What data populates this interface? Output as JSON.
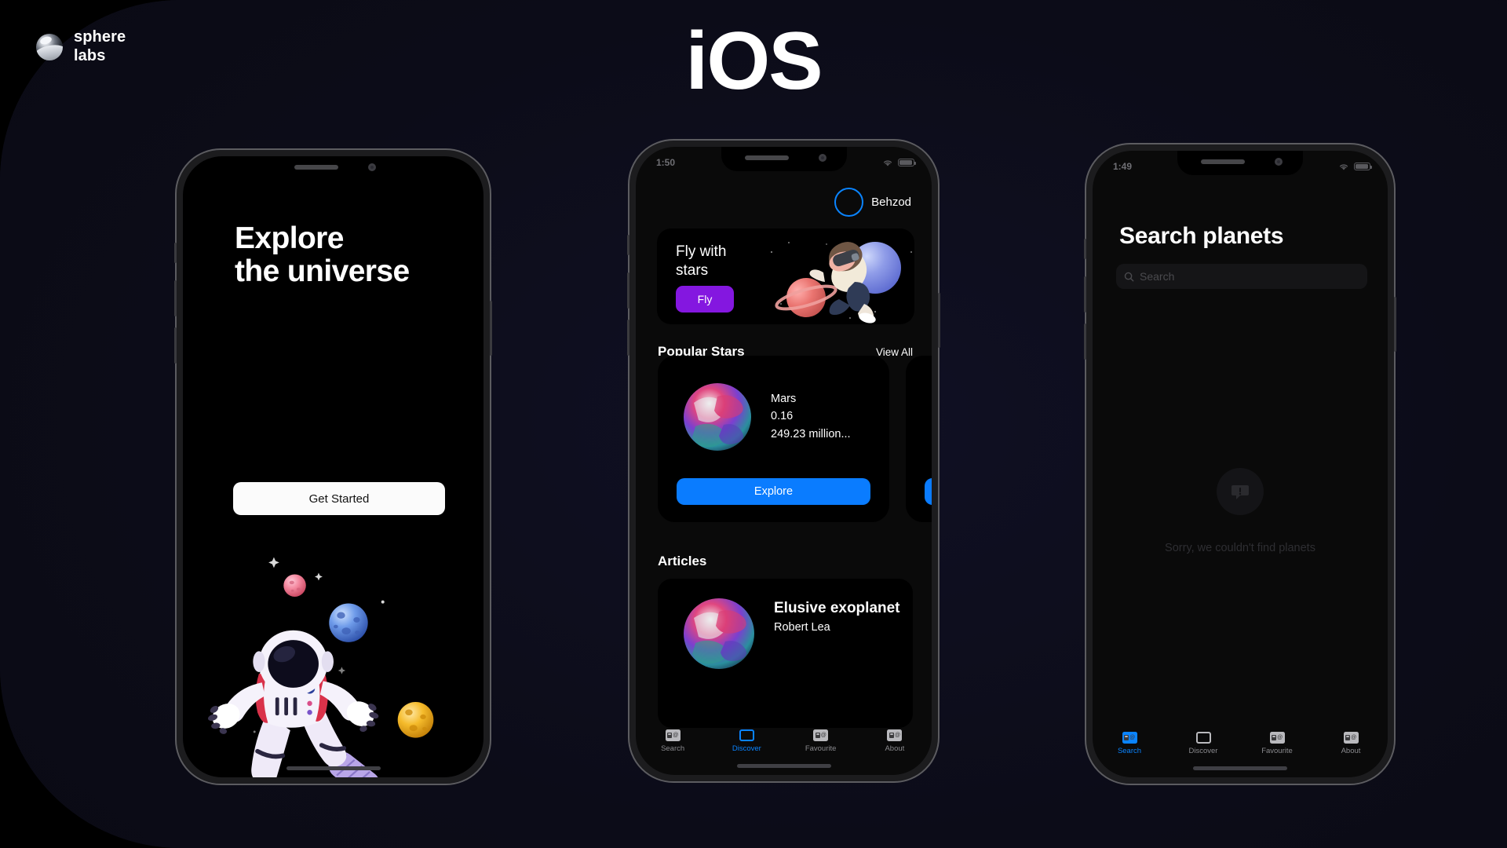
{
  "brand": {
    "line1": "sphere",
    "line2": "labs",
    "logo_icon": "sphere-logo-icon"
  },
  "page_title": "iOS",
  "colors": {
    "background": "#000000",
    "panel": "#0d0d1a",
    "accent_blue": "#0a84ff",
    "accent_purple": "#8417e0",
    "white": "#ffffff"
  },
  "phone1": {
    "status": {
      "time": "",
      "wifi_icon": "wifi-icon",
      "battery_icon": "battery-icon"
    },
    "headline_line1": "Explore",
    "headline_line2": "the universe",
    "cta_label": "Get Started",
    "illustration": "floating-astronaut-illustration"
  },
  "phone2": {
    "status": {
      "time": "1:50",
      "wifi_icon": "wifi-icon",
      "battery_icon": "battery-icon"
    },
    "user": {
      "name": "Behzod",
      "avatar_icon": "avatar-icon"
    },
    "promo": {
      "title": "Fly with stars",
      "button_label": "Fly",
      "illustration": "vr-kid-planets-illustration"
    },
    "popular": {
      "section_title": "Popular Stars",
      "view_all_label": "View All",
      "cards": [
        {
          "name": "Mars",
          "value": "0.16",
          "distance": "249.23 million...",
          "button_label": "Explore"
        },
        {
          "name": "",
          "value": "",
          "distance": "",
          "button_label": ""
        }
      ]
    },
    "articles": {
      "section_title": "Articles",
      "items": [
        {
          "title": "Elusive exoplanet",
          "author": "Robert Lea",
          "thumb_icon": "planet-thumb-icon"
        }
      ]
    },
    "tabs": [
      {
        "label": "Search",
        "icon": "placeholder-image-icon",
        "active": false
      },
      {
        "label": "Discover",
        "icon": "rounded-box-icon",
        "active": true
      },
      {
        "label": "Favourite",
        "icon": "placeholder-image-icon",
        "active": false
      },
      {
        "label": "About",
        "icon": "placeholder-image-icon",
        "active": false
      }
    ]
  },
  "phone3": {
    "status": {
      "time": "1:49",
      "wifi_icon": "wifi-icon",
      "battery_icon": "battery-icon"
    },
    "title": "Search  planets",
    "search": {
      "placeholder": "Search",
      "value": "",
      "icon": "search-icon"
    },
    "empty_state": {
      "icon": "message-alert-icon",
      "text": "Sorry, we couldn't find planets"
    },
    "tabs": [
      {
        "label": "Search",
        "icon": "placeholder-image-icon",
        "active": true
      },
      {
        "label": "Discover",
        "icon": "rounded-box-icon",
        "active": false
      },
      {
        "label": "Favourite",
        "icon": "placeholder-image-icon",
        "active": false
      },
      {
        "label": "About",
        "icon": "placeholder-image-icon",
        "active": false
      }
    ]
  }
}
